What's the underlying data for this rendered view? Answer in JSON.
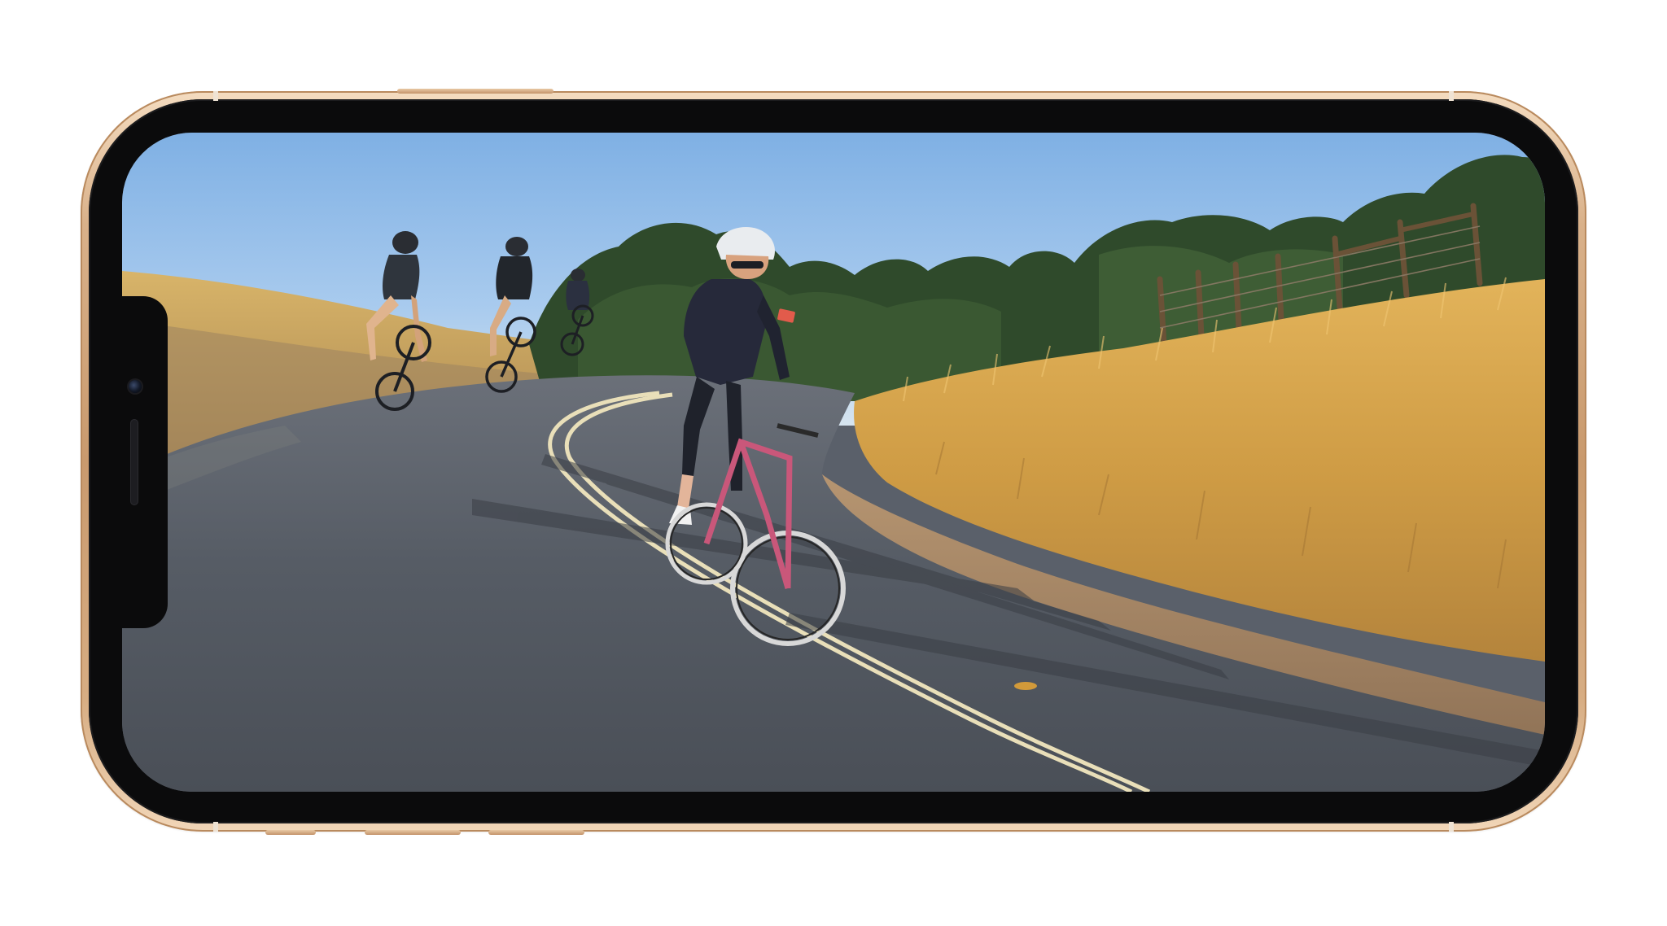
{
  "device": {
    "frame_color": "#d2a57a",
    "bezel_color": "#0b0b0c",
    "background_color": "#ffffff"
  },
  "screen": {
    "content": "photo",
    "sky_color": "#86b4e6",
    "road_color": "#4f555d",
    "grass_color": "#d4a94f"
  },
  "icons": {
    "camera": "front-camera-icon",
    "speaker": "earpiece-speaker-icon"
  }
}
